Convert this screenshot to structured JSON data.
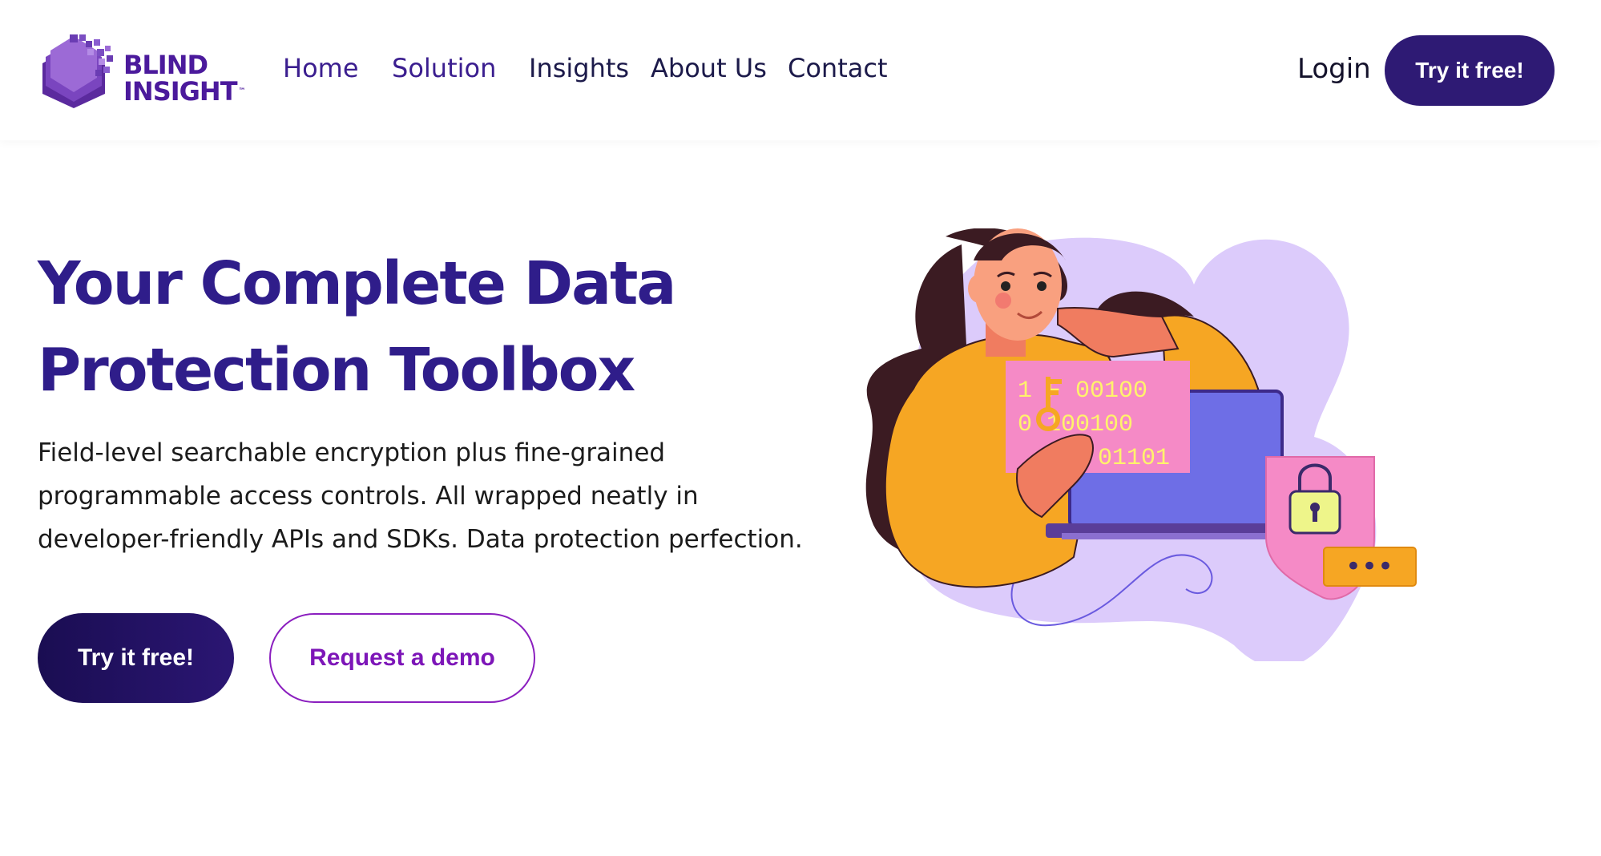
{
  "brand": {
    "line1": "BLIND",
    "line2": "INSIGHT",
    "tm": "™"
  },
  "nav": {
    "items": [
      {
        "label": "Home"
      },
      {
        "label": "Solution"
      },
      {
        "label": "Insights"
      },
      {
        "label": "About Us"
      },
      {
        "label": "Contact"
      }
    ],
    "login": "Login",
    "cta": "Try it free!"
  },
  "hero": {
    "title_line1": "Your Complete Data",
    "title_line2": "Protection Toolbox",
    "desc_line1": "Field-level searchable encryption plus fine-grained",
    "desc_line2": "programmable access controls. All wrapped neatly in",
    "desc_line3": "developer-friendly APIs and SDKs. Data protection perfection.",
    "primary_button": "Try it free!",
    "secondary_button": "Request a demo"
  },
  "illustration": {
    "binary_row1": "1 F 00100",
    "binary_row2": "0 100100",
    "binary_row3": "01101",
    "password_dots": "•••"
  },
  "colors": {
    "brand_purple": "#2e1a74",
    "title_purple": "#2f1d8a",
    "accent_violet": "#8b1fbf",
    "illustration_lavender": "#dccbfb"
  }
}
